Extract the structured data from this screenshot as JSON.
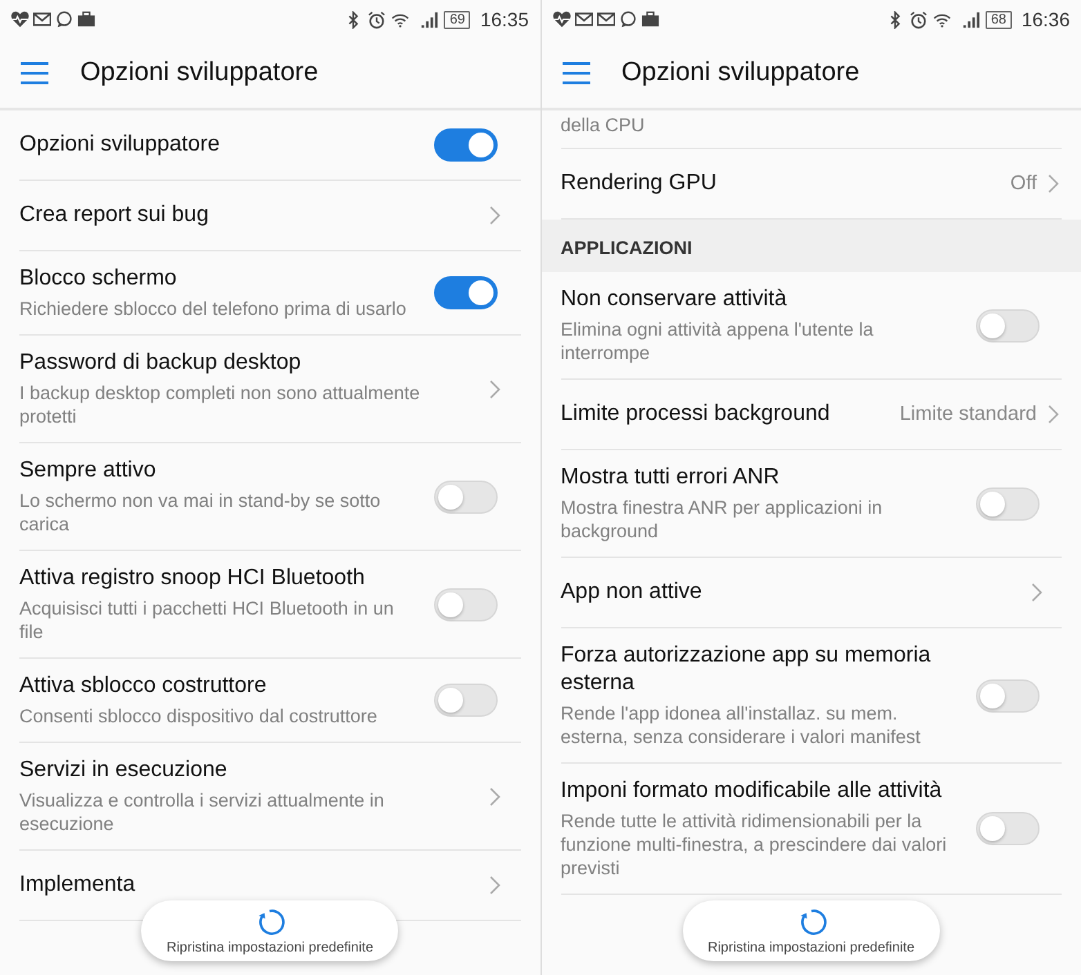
{
  "screens": [
    {
      "status_bar": {
        "notification_icons": [
          {
            "kind": "heart"
          },
          {
            "kind": "mail"
          },
          {
            "kind": "chat"
          },
          {
            "kind": "briefcase"
          }
        ],
        "battery": "69",
        "time": "16:35"
      },
      "app_bar": {
        "title": "Opzioni sviluppatore"
      },
      "rows": [
        {
          "kind": "toggle",
          "title": "Opzioni sviluppatore",
          "on": true
        },
        {
          "kind": "link",
          "title": "Crea report sui bug"
        },
        {
          "kind": "toggle",
          "title": "Blocco schermo",
          "subtitle": "Richiedere sblocco del telefono prima di usarlo",
          "on": true
        },
        {
          "kind": "link",
          "title": "Password di backup desktop",
          "subtitle": "I backup desktop completi non sono attualmente protetti"
        },
        {
          "kind": "toggle",
          "title": "Sempre attivo",
          "subtitle": "Lo schermo non va mai in stand-by se sotto carica",
          "on": false
        },
        {
          "kind": "toggle",
          "title": "Attiva registro snoop HCI Bluetooth",
          "subtitle": "Acquisisci tutti i pacchetti HCI Bluetooth in un file",
          "on": false
        },
        {
          "kind": "toggle",
          "title": "Attiva sblocco costruttore",
          "subtitle": "Consenti sblocco dispositivo dal costruttore",
          "on": false
        },
        {
          "kind": "link",
          "title": "Servizi in esecuzione",
          "subtitle": "Visualizza e controlla i servizi attualmente in esecuzione"
        },
        {
          "kind": "link",
          "title": "Implementa"
        }
      ],
      "toast": {
        "text": "Ripristina impostazioni predefinite"
      }
    },
    {
      "status_bar": {
        "notification_icons": [
          {
            "kind": "heart"
          },
          {
            "kind": "mail"
          },
          {
            "kind": "mail"
          },
          {
            "kind": "chat"
          },
          {
            "kind": "briefcase"
          }
        ],
        "battery": "68",
        "time": "16:36"
      },
      "app_bar": {
        "title": "Opzioni sviluppatore"
      },
      "rows": [
        {
          "kind": "partial",
          "subtitle": "della CPU"
        },
        {
          "kind": "link",
          "title": "Rendering GPU",
          "value": "Off"
        },
        {
          "kind": "header",
          "title": "APPLICAZIONI"
        },
        {
          "kind": "toggle",
          "title": "Non conservare attività",
          "subtitle": "Elimina ogni attività appena l'utente la interrompe",
          "on": false
        },
        {
          "kind": "link",
          "title": "Limite processi background",
          "value": "Limite standard"
        },
        {
          "kind": "toggle",
          "title": "Mostra tutti errori ANR",
          "subtitle": "Mostra finestra ANR per applicazioni in background",
          "on": false
        },
        {
          "kind": "link",
          "title": "App non attive"
        },
        {
          "kind": "toggle",
          "title": "Forza autorizzazione app su memoria esterna",
          "subtitle": "Rende l'app idonea all'installaz. su mem. esterna, senza considerare i valori manifest",
          "on": false
        },
        {
          "kind": "toggle",
          "title": "Imponi formato modificabile alle attività",
          "subtitle": "Rende tutte le attività ridimensionabili per la funzione multi-finestra, a prescindere dai valori previsti",
          "on": false
        }
      ],
      "toast": {
        "text": "Ripristina impostazioni predefinite"
      }
    }
  ]
}
